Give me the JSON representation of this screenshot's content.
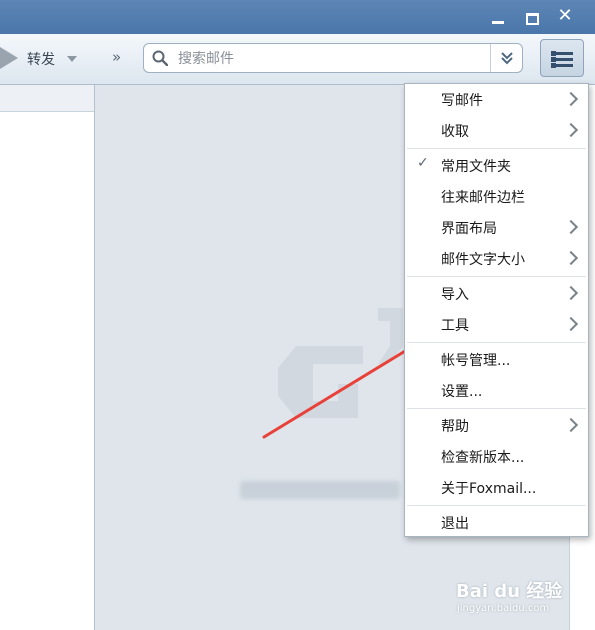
{
  "titlebar": {
    "minimize_icon": "minimize-icon",
    "maximize_icon": "maximize-icon",
    "close_label": "✕"
  },
  "toolbar": {
    "forward_label": "转发",
    "more_label": "»",
    "menu_icon": "hamburger-menu-icon"
  },
  "search": {
    "placeholder": "搜索邮件",
    "options_label": "»"
  },
  "menu": {
    "items": [
      {
        "label": "写邮件",
        "submenu": true
      },
      {
        "label": "收取",
        "submenu": true
      },
      {
        "label": "常用文件夹",
        "checked": true
      },
      {
        "label": "往来邮件边栏"
      },
      {
        "label": "界面布局",
        "submenu": true
      },
      {
        "label": "邮件文字大小",
        "submenu": true
      },
      {
        "label": "导入",
        "submenu": true
      },
      {
        "label": "工具",
        "submenu": true
      },
      {
        "label": "帐号管理..."
      },
      {
        "label": "设置..."
      },
      {
        "label": "帮助",
        "submenu": true
      },
      {
        "label": "检查新版本..."
      },
      {
        "label": "关于Foxmail..."
      },
      {
        "label": "退出"
      }
    ]
  },
  "watermark": {
    "text": "Bai du 经验",
    "url": "jingyan.baidu.com"
  },
  "colors": {
    "titlebar": "#4a76aa",
    "annotation_arrow": "#e8413a",
    "menu_bg": "#ffffff"
  }
}
